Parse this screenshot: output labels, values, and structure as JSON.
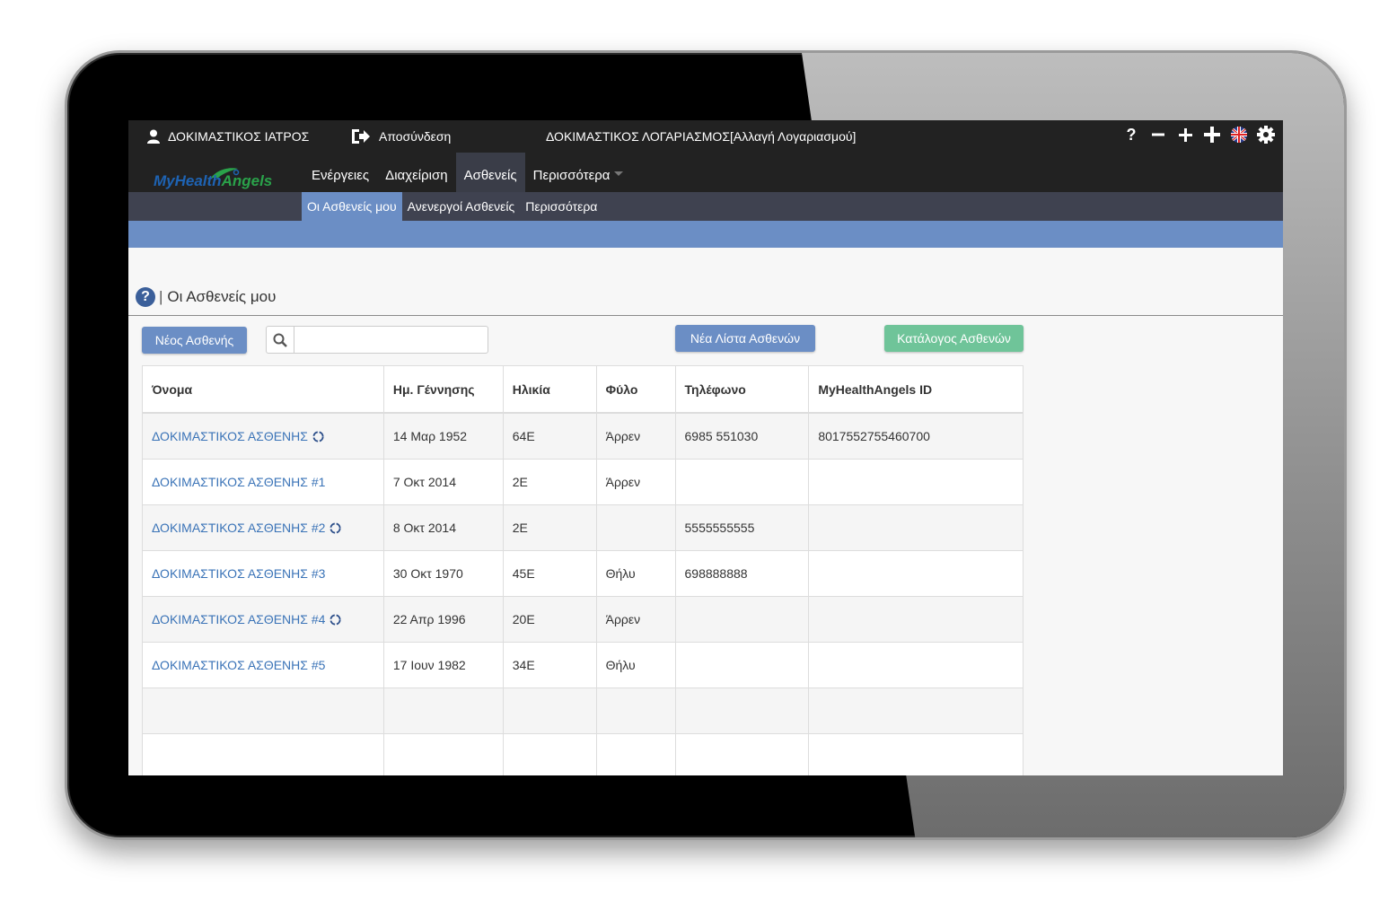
{
  "header": {
    "user_name": "ΔΟΚΙΜΑΣΤΙΚΟΣ ΙΑΤΡΟΣ",
    "logout_label": "Αποσύνδεση",
    "account_label": "ΔΟΚΙΜΑΣΤΙΚΟΣ ΛΟΓΑΡΙΑΣΜΟΣ[Αλλαγή Λογαριασμού]",
    "icons": [
      "help-icon",
      "zoom-out-icon",
      "zoom-in-icon",
      "add-icon",
      "language-flag-icon",
      "settings-icon"
    ]
  },
  "logo": {
    "part1": "MyHealth",
    "part2": "Angels"
  },
  "nav": {
    "items": [
      "Ενέργειες",
      "Διαχείριση",
      "Ασθενείς",
      "Περισσότερα"
    ],
    "active": "Ασθενείς"
  },
  "subnav": {
    "items": [
      "Οι Ασθενείς μου",
      "Ανενεργοί Ασθενείς",
      "Περισσότερα"
    ],
    "active": "Οι Ασθενείς μου"
  },
  "page": {
    "title": "Οι Ασθενείς μου",
    "new_patient_button": "Νέος Ασθενής",
    "search_value": "",
    "new_list_button": "Νέα Λίστα Ασθενών",
    "catalog_button": "Κατάλογος Ασθενών"
  },
  "table": {
    "headers": [
      "Όνομα",
      "Ημ. Γέννησης",
      "Ηλικία",
      "Φύλο",
      "Τηλέφωνο",
      "MyHealthAngels ID"
    ],
    "rows": [
      {
        "name": "ΔΟΚΙΜΑΣΤΙΚΟΣ ΑΣΘΕΝΗΣ",
        "dob": "14 Μαρ 1952",
        "age": "64Ε",
        "sex": "Άρρεν",
        "phone": "6985 551030",
        "id": "8017552755460700",
        "synced": true
      },
      {
        "name": "ΔΟΚΙΜΑΣΤΙΚΟΣ ΑΣΘΕΝΗΣ #1",
        "dob": "7 Οκτ 2014",
        "age": "2Ε",
        "sex": "Άρρεν",
        "phone": "",
        "id": "",
        "synced": false
      },
      {
        "name": "ΔΟΚΙΜΑΣΤΙΚΟΣ ΑΣΘΕΝΗΣ #2",
        "dob": "8 Οκτ 2014",
        "age": "2Ε",
        "sex": "",
        "phone": "5555555555",
        "id": "",
        "synced": true
      },
      {
        "name": "ΔΟΚΙΜΑΣΤΙΚΟΣ ΑΣΘΕΝΗΣ #3",
        "dob": "30 Οκτ 1970",
        "age": "45Ε",
        "sex": "Θήλυ",
        "phone": "698888888",
        "id": "",
        "synced": false
      },
      {
        "name": "ΔΟΚΙΜΑΣΤΙΚΟΣ ΑΣΘΕΝΗΣ #4",
        "dob": "22 Απρ 1996",
        "age": "20Ε",
        "sex": "Άρρεν",
        "phone": "",
        "id": "",
        "synced": true
      },
      {
        "name": "ΔΟΚΙΜΑΣΤΙΚΟΣ ΑΣΘΕΝΗΣ #5",
        "dob": "17 Ιουν 1982",
        "age": "34Ε",
        "sex": "Θήλυ",
        "phone": "",
        "id": "",
        "synced": false
      }
    ],
    "empty_rows": 2
  },
  "colors": {
    "topbar": "#222222",
    "subnav": "#3f4250",
    "accent_blue": "#6b8ec5",
    "accent_green": "#6fc499",
    "link": "#3a73b7"
  }
}
